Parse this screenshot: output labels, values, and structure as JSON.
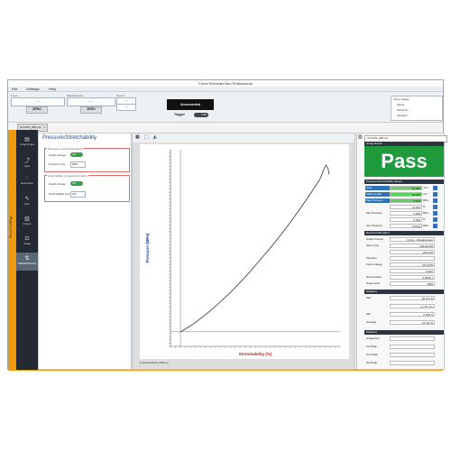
{
  "window": {
    "title": "Force Recorder Neo Professional"
  },
  "menu": [
    "File",
    "Settings",
    "Help"
  ],
  "toolbar": {
    "force_label": "Force",
    "force_value": "-- --",
    "force_zero": "ZERO",
    "disp_label": "Displacement",
    "disp_value": "-- --",
    "disp_zero": "ZERO",
    "speed_label": "Speed",
    "speed_value": "--",
    "speed_value2": "--",
    "status": "Unconnected",
    "trigger_label": "Trigger",
    "trigger_state": "OFF"
  },
  "info_panel": [
    "Force Gauge",
    "Model",
    "Serial No.",
    "Operator"
  ],
  "tab": {
    "label": "CILILDS_008.csv"
  },
  "sidebar": {
    "label": "Record Settings"
  },
  "nav": [
    {
      "icon": "graph-data-icon",
      "glyph": "▤",
      "label": "Graph Data"
    },
    {
      "icon": "view-icon",
      "glyph": "⤴",
      "label": "View"
    },
    {
      "icon": "resolution-icon",
      "glyph": "◌",
      "label": "Resolution"
    },
    {
      "icon": "edit-icon",
      "glyph": "✎",
      "label": "Edit"
    },
    {
      "icon": "output-icon",
      "glyph": "▥",
      "label": "Output"
    },
    {
      "icon": "judge-icon",
      "glyph": "⚖",
      "label": "Judge"
    },
    {
      "icon": "press-stretch-icon",
      "glyph": "⇅",
      "label": "PRESS/Stretch"
    }
  ],
  "settings": {
    "title": "Pressure/Stretchability",
    "group1": {
      "label": "Pressure or Area Information",
      "graph_change_label": "Graph change",
      "graph_change_toggle": "ON",
      "pressure_unit_label": "Pressure Unit",
      "pressure_unit_value": "MPa"
    },
    "group2": {
      "label": "Stretchability or Area Information",
      "graph_change_label": "Graph change",
      "graph_change_toggle": "ON",
      "stretch_unit_label": "Stretchability Unit",
      "stretch_unit_value": "(%)"
    }
  },
  "chart_footer": "C:\\sel\\CILILDS_008.csv",
  "chart_data": {
    "type": "line",
    "ylabel": "Pressure (MPa)",
    "xlabel": "Stretchability (%)",
    "x": [
      0,
      5,
      10,
      15,
      20,
      25,
      30,
      35,
      40,
      45,
      50,
      55,
      60,
      65,
      70,
      72,
      73,
      74,
      74.5
    ],
    "y": [
      0,
      0.8,
      1.8,
      2.9,
      4.1,
      5.4,
      6.8,
      8.3,
      9.9,
      11.5,
      13.2,
      15.0,
      16.9,
      18.9,
      21.0,
      22.4,
      22.9,
      22.4,
      21.6
    ],
    "xlim": [
      -5,
      80
    ],
    "ylim": [
      -2,
      25
    ],
    "grid": false,
    "color": "#333333"
  },
  "results": {
    "file": "CILILDS_008.csv",
    "judge_header": "Judge Result",
    "judge": "Pass",
    "pv_header": "Pressure/Stretchability Values",
    "pv_rows": [
      {
        "label": "Area",
        "value": "10.000",
        "unit": "mm²",
        "hl": true,
        "g": true
      },
      {
        "label": "Initial Length",
        "value": "50.000",
        "unit": "mm",
        "hl": true,
        "g": true
      },
      {
        "label": "Max Pressure",
        "value": "1.918",
        "unit": "MPa",
        "hl": true,
        "g": true
      },
      {
        "label": "",
        "value": "41.600",
        "unit": "%",
        "hl": false,
        "g": false
      },
      {
        "label": "Min Pressure",
        "value": "0.000",
        "unit": "MPa",
        "hl": false,
        "g": false
      },
      {
        "label": "",
        "value": "0.000",
        "unit": "%",
        "hl": false,
        "g": false
      },
      {
        "label": "Ave Pressure",
        "value": "0.0102",
        "unit": "MPa",
        "hl": false,
        "g": false
      }
    ],
    "rec_header": "Record Information",
    "rec_rows": [
      {
        "label": "Graph Format",
        "value": "Force - Displacement"
      },
      {
        "label": "Save Time",
        "value": "2024/11/28"
      },
      {
        "label": "",
        "value": "15:01:06"
      },
      {
        "label": "Operator",
        "value": ""
      },
      {
        "label": "Force Gauge",
        "value": "ZTA-50N"
      },
      {
        "label": "",
        "value": "12345"
      },
      {
        "label": "Record Rate",
        "value": "0.0005 s"
      },
      {
        "label": "Data Count",
        "value": "4006"
      }
    ],
    "stat_header": "Statistics",
    "stat_rows": [
      {
        "label": "Max",
        "value": "50.671 N"
      },
      {
        "label": "",
        "value": "4.770 mm"
      },
      {
        "label": "Min",
        "value": "0.000 N"
      },
      {
        "label": "Average",
        "value": "27.111 N"
      }
    ],
    "stat2_header": "Statistics",
    "stat2_rows": [
      {
        "label": "Judgement",
        "value": ""
      },
      {
        "label": "1st Peak",
        "value": ""
      },
      {
        "label": "2nd Peak",
        "value": ""
      },
      {
        "label": "3rd Peak",
        "value": ""
      }
    ]
  }
}
